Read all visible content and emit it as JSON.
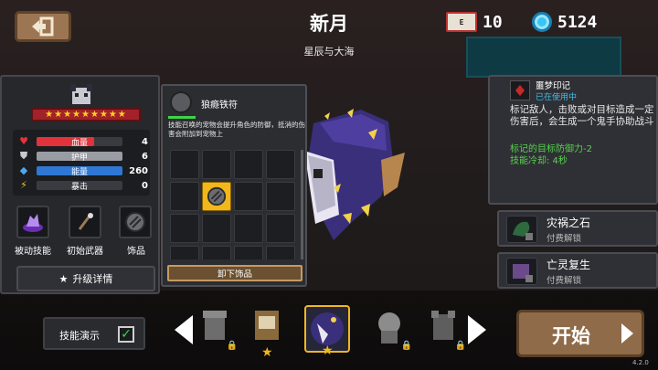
{
  "header": {
    "title": "新月",
    "subtitle": "星辰与大海",
    "ticket_count": "10",
    "gem_count": "5124"
  },
  "character": {
    "stars": "★★★★★★★★★",
    "stats": [
      {
        "label": "血量",
        "value": "4",
        "fill": 0.67,
        "color": "#e2323c",
        "icon": "heart-icon"
      },
      {
        "label": "护甲",
        "value": "6",
        "fill": 1.0,
        "color": "#9a9ca3",
        "icon": "shield-icon"
      },
      {
        "label": "能量",
        "value": "260",
        "fill": 1.0,
        "color": "#2f77d4",
        "icon": "energy-icon"
      },
      {
        "label": "暴击",
        "value": "0",
        "fill": 0.0,
        "color": "#8a8a8a",
        "icon": "crit-icon"
      }
    ],
    "slots": {
      "passive_label": "被动技能",
      "weapon_label": "初始武器",
      "accessory_label": "饰品"
    },
    "upgrade_label": "升级详情"
  },
  "accessory": {
    "name": "狼瘾铁符",
    "description": "技能召唤的宠物会提升角色的防御，抵消的伤害会附加到宠物上",
    "unequip_label": "卸下饰品"
  },
  "skill": {
    "title": "噩梦印记",
    "status": "已在使用中",
    "description": "标记敌人，击败或对目标造成一定伤害后，会生成一个鬼手协助战斗",
    "effect": "标记的目标防御力-2",
    "cooldown": "技能冷却: 4秒"
  },
  "locked_skills": [
    {
      "name": "灾祸之石",
      "sub": "付费解锁"
    },
    {
      "name": "亡灵复生",
      "sub": "付费解锁"
    }
  ],
  "bottom": {
    "demo_label": "技能演示",
    "start_label": "开始",
    "version": "4.2.0"
  },
  "colors": {
    "accent_gold": "#f1b71d",
    "button_brown": "#8f6b49",
    "status_blue": "#3fbfe8",
    "effect_green": "#57d24f"
  }
}
